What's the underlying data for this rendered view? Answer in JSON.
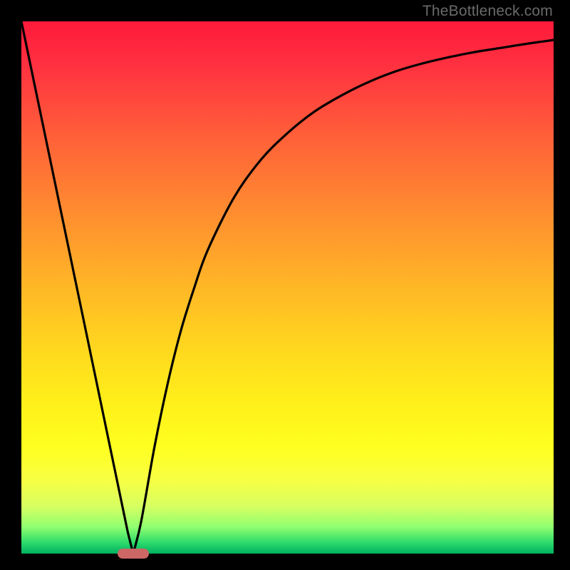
{
  "watermark": "TheBottleneck.com",
  "chart_data": {
    "type": "line",
    "title": "",
    "xlabel": "",
    "ylabel": "",
    "xlim": [
      0,
      100
    ],
    "ylim": [
      0,
      100
    ],
    "grid": false,
    "legend": false,
    "series": [
      {
        "name": "bottleneck-curve",
        "x": [
          0,
          2.5,
          5,
          7.5,
          10,
          12.5,
          15,
          17.5,
          20,
          21,
          22.5,
          25,
          27.5,
          30,
          32.5,
          35,
          40,
          45,
          50,
          55,
          60,
          65,
          70,
          75,
          80,
          85,
          90,
          95,
          100
        ],
        "values": [
          100,
          88,
          76,
          64,
          52,
          40,
          28,
          16,
          4,
          0,
          6,
          20,
          32,
          42,
          50,
          57,
          67,
          74,
          79,
          83,
          86,
          88.5,
          90.5,
          92,
          93.2,
          94.2,
          95,
          95.8,
          96.5
        ]
      }
    ],
    "annotations": [
      {
        "name": "optimal-marker",
        "x": 21,
        "y": 0
      }
    ],
    "background_gradient": {
      "direction": "top-to-bottom",
      "stops": [
        {
          "pos": 0,
          "color": "#ff1a3a"
        },
        {
          "pos": 35,
          "color": "#ff8a30"
        },
        {
          "pos": 72,
          "color": "#fff01a"
        },
        {
          "pos": 100,
          "color": "#00b060"
        }
      ]
    }
  }
}
